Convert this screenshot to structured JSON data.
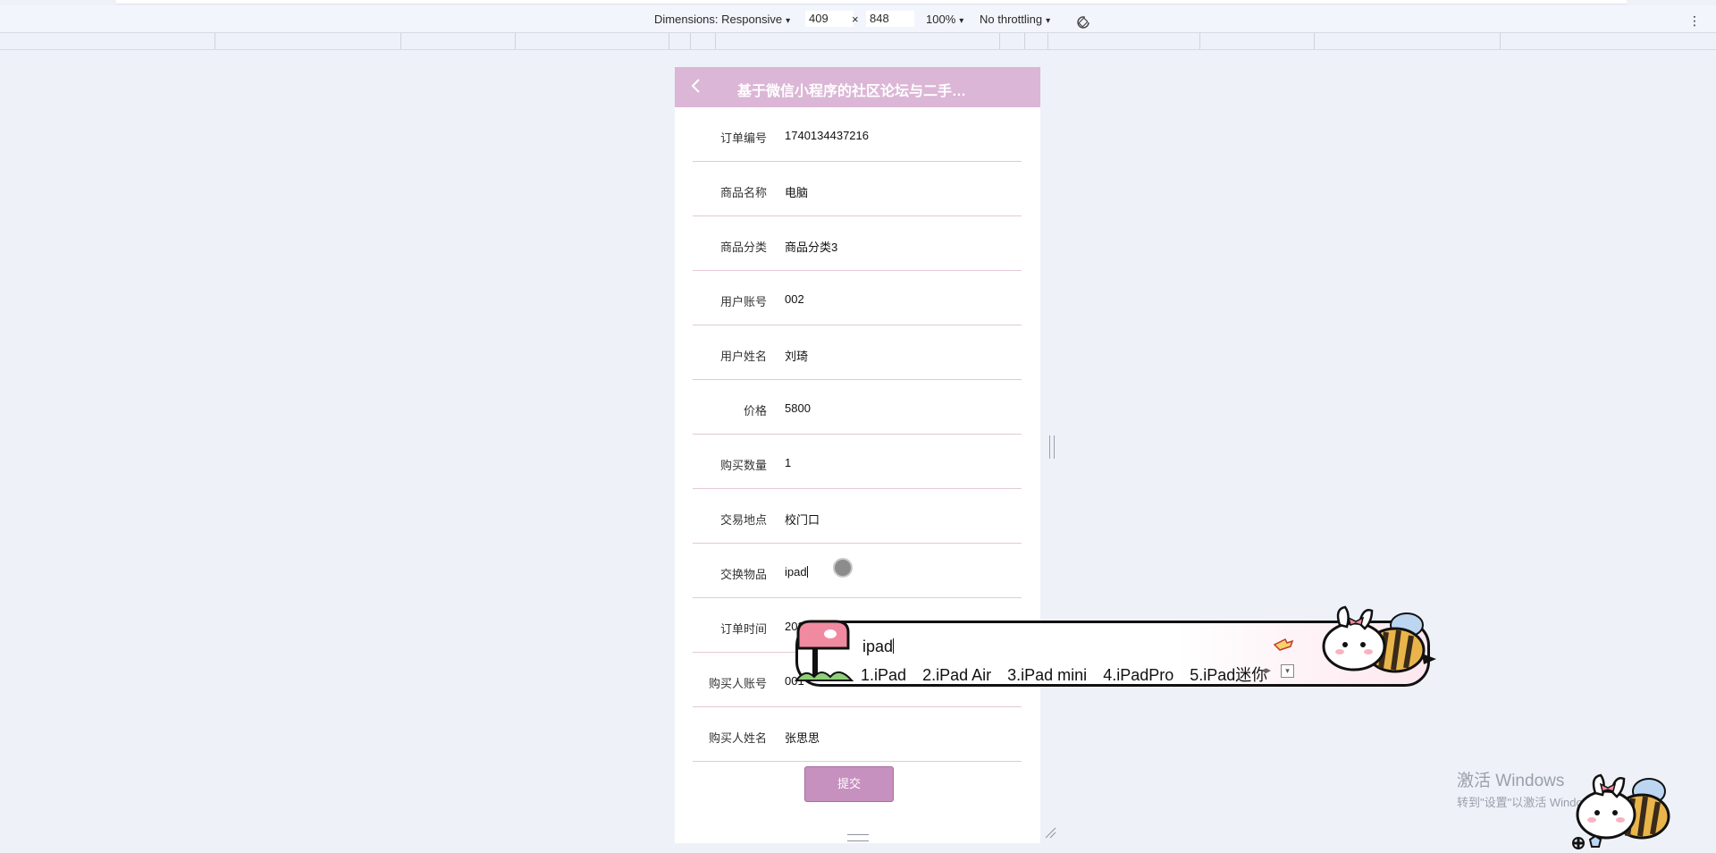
{
  "devtools": {
    "dimensions_label": "Dimensions: Responsive",
    "width": "409",
    "times": "×",
    "height": "848",
    "zoom": "100%",
    "throttling": "No throttling",
    "caret": "▾",
    "menu": "⋮"
  },
  "app": {
    "title": "基于微信小程序的社区论坛与二手…"
  },
  "form": {
    "rows": [
      {
        "label": "订单编号",
        "value": "1740134437216"
      },
      {
        "label": "商品名称",
        "value": "电脑"
      },
      {
        "label": "商品分类",
        "value": "商品分类3"
      },
      {
        "label": "用户账号",
        "value": "002"
      },
      {
        "label": "用户姓名",
        "value": "刘琦"
      },
      {
        "label": "价格",
        "value": "5800"
      },
      {
        "label": "购买数量",
        "value": "1"
      },
      {
        "label": "交易地点",
        "value": "校门口"
      },
      {
        "label": "交换物品",
        "value": "ipad"
      },
      {
        "label": "订单时间",
        "value": "2025-02-21 18:40:37"
      },
      {
        "label": "购买人账号",
        "value": "001"
      },
      {
        "label": "购买人姓名",
        "value": "张思思"
      }
    ],
    "submit_label": "提交"
  },
  "ime": {
    "composition": "ipad",
    "candidates": [
      "1.iPad",
      "2.iPad Air",
      "3.iPad mini",
      "4.iPadPro",
      "5.iPad迷你"
    ],
    "pager": "◂▸",
    "expand": "▾"
  },
  "watermark": {
    "line1": "激活 Windows",
    "line2": "转到\"设置\"以激活 Windows。"
  },
  "colors": {
    "navbar": "#dbb6d6",
    "submit": "#c690bf",
    "divider": "#e4c8d8"
  }
}
